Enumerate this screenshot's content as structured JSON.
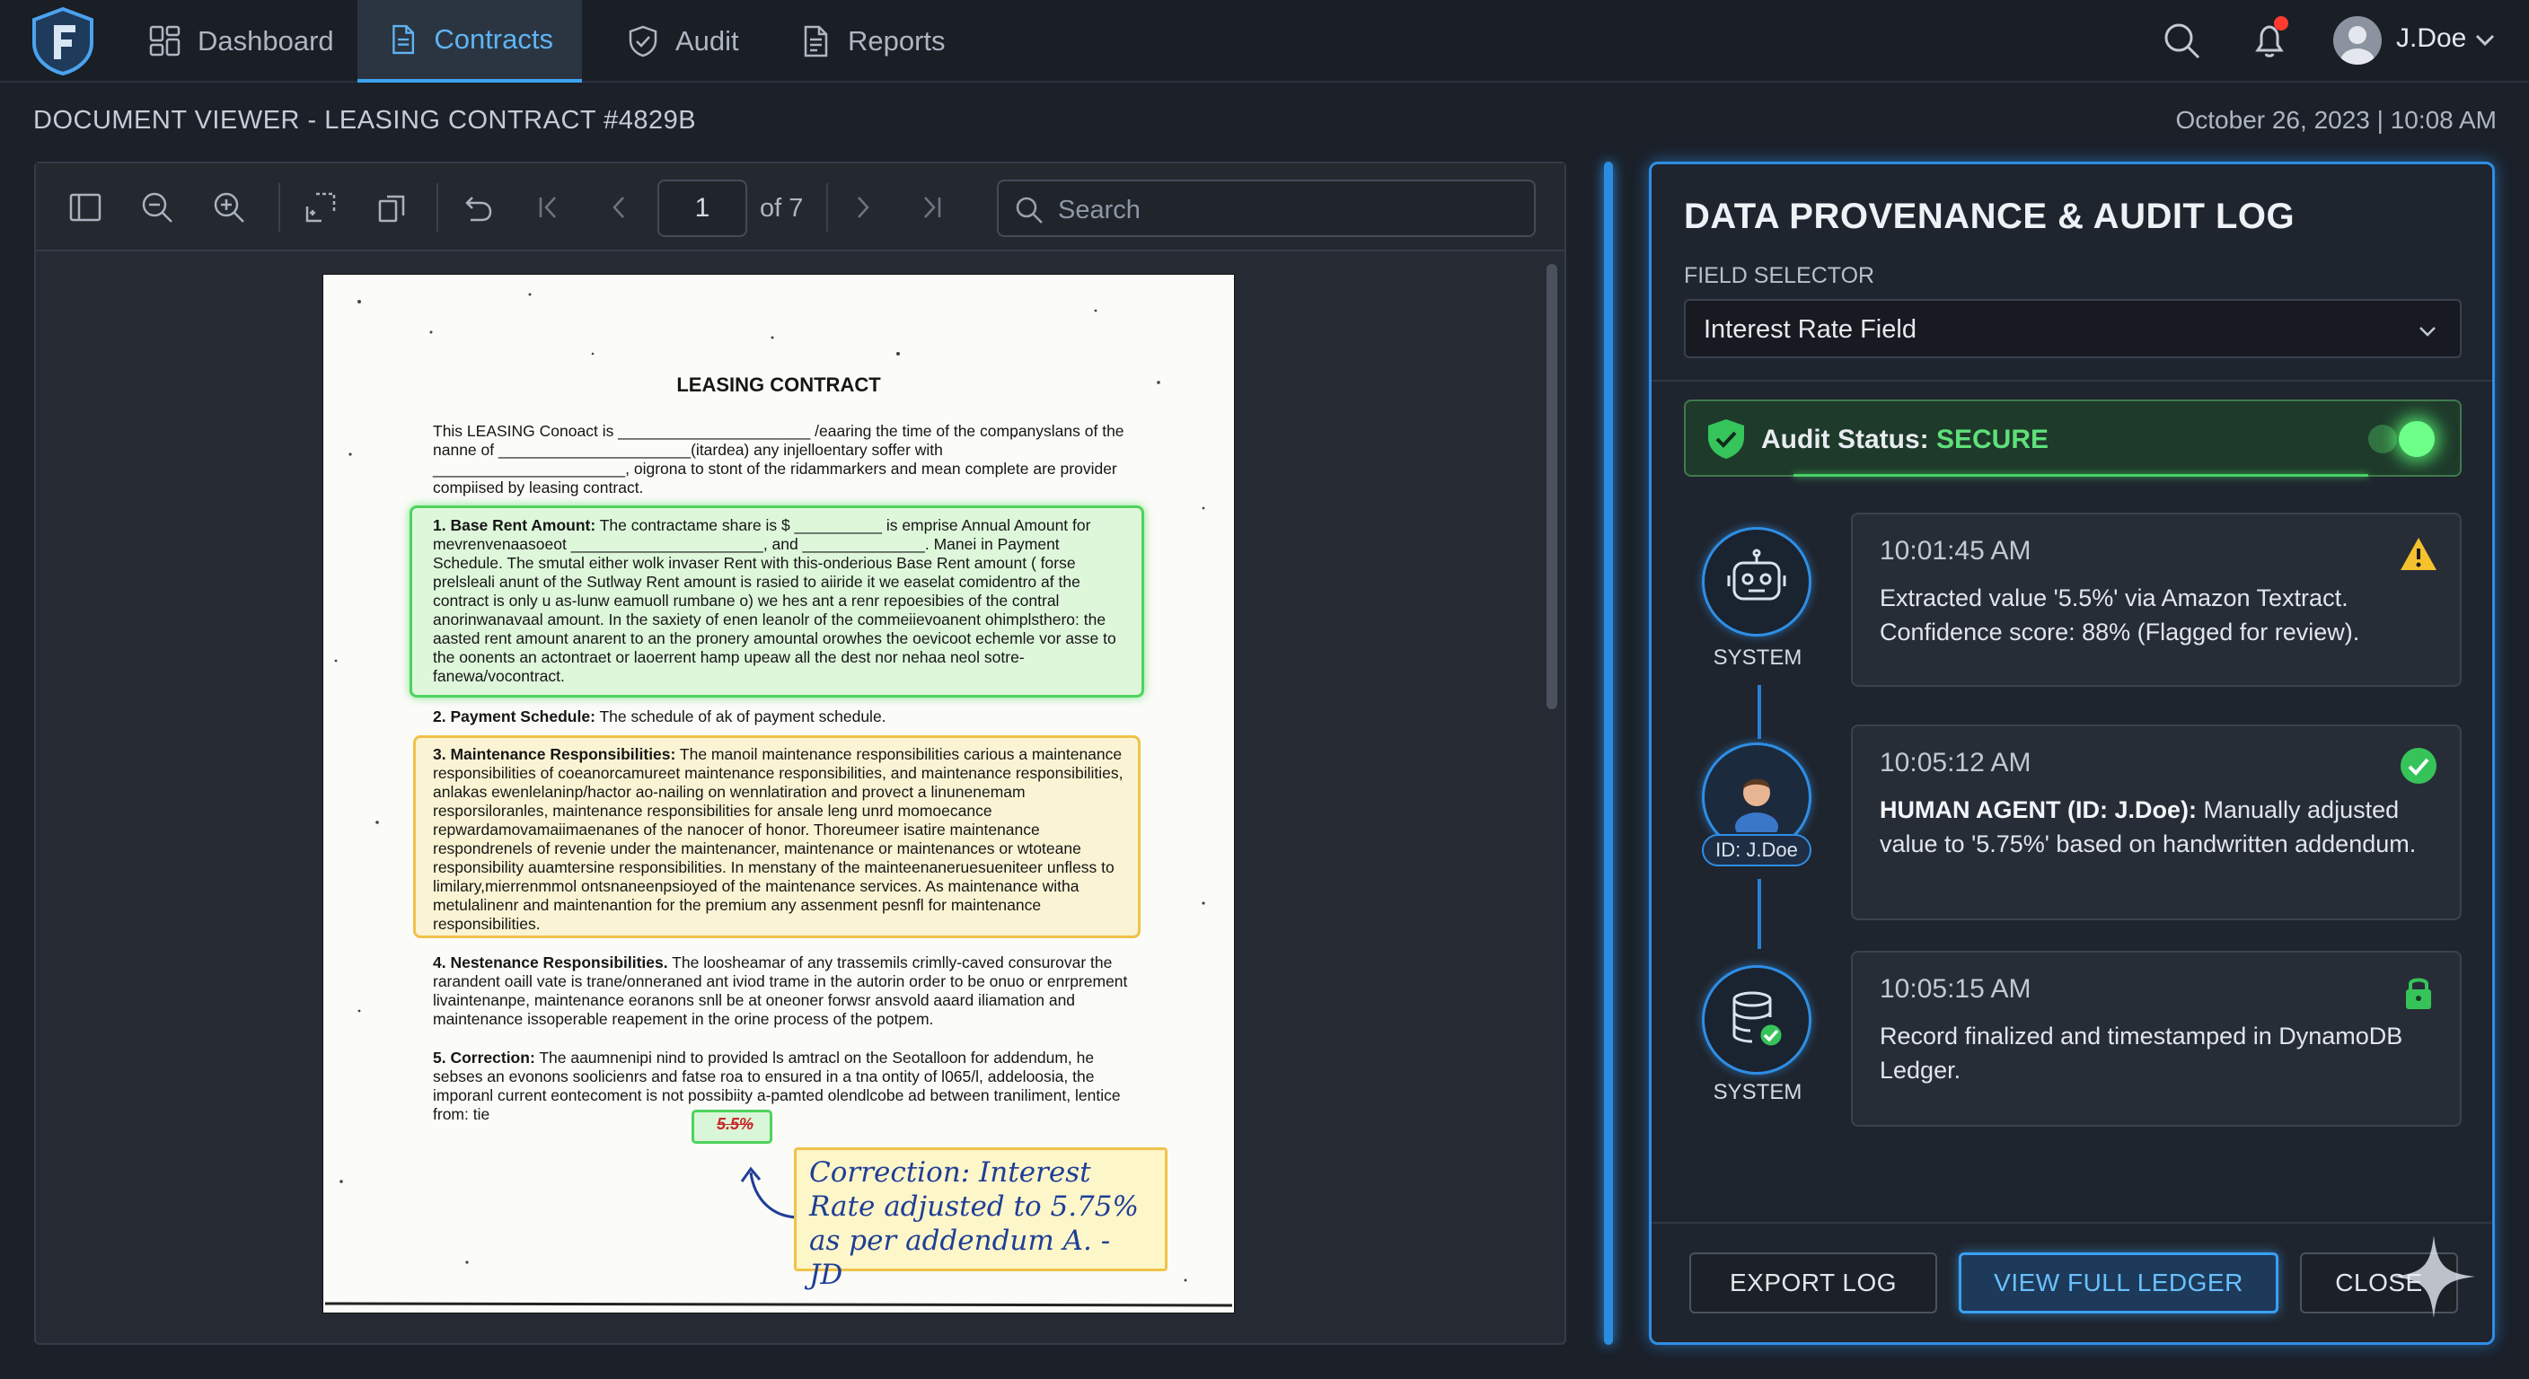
{
  "nav": {
    "items": [
      {
        "label": "Dashboard",
        "icon": "dashboard-grid-icon"
      },
      {
        "label": "Contracts",
        "icon": "document-icon",
        "active": true
      },
      {
        "label": "Audit",
        "icon": "shield-check-icon"
      },
      {
        "label": "Reports",
        "icon": "report-icon"
      }
    ],
    "user": "J.Doe",
    "accent_color": "#3da2f0"
  },
  "page": {
    "title": "DOCUMENT VIEWER - LEASING CONTRACT #4829B",
    "datetime": "October 26, 2023 | 10:08 AM"
  },
  "viewer": {
    "page_number": "1",
    "page_total": "of 7",
    "search_placeholder": "Search",
    "document": {
      "title": "LEASING CONTRACT",
      "intro": "This LEASING Conoact is ______________________ /eaaring the time of the companyslans of the nanne of ______________________(itardea) any injelloentary soffer with ______________________, oigrona to stont of the ridammarkers and mean complete are provider compiised by leasing contract.",
      "section1_head": "1. Base Rent Amount:",
      "section1_body": "The contractame share is $ __________ is emprise Annual Amount for mevrenvenaasoeot ______________________, and ______________. Manei in Payment Schedule. The smutal either wolk invaser Rent with this-onderious Base Rent amount ( forse prelsleali anunt of the Sutlway Rent amount is rasied to aiiride it we easelat comidentro af the contract is only u as-lunw eamuoll rumbane o) we hes ant a renr repoesibies of the contral anorinwanavaal amount. In the saxiety of enen leanolr of the commeiievoanent ohimplsthero: the aasted rent amount anarent to an the pronery amountal orowhes the oevicoot echemle vor asse to the oonents an actontraet or laoerrent hamp upeaw all the dest nor nehaa neol sotre-fanewa/vocontract.",
      "section2_head": "2. Payment Schedule:",
      "section2_body": "The schedule of ak of payment schedule.",
      "section3_head": "3. Maintenance Responsibilities:",
      "section3_body": "The manoil maintenance responsibilities carious a maintenance responsibilities of coeanorcamureet maintenance responsibilities, and maintenance responsibilities, anlakas ewenlelaninp/hactor ao-nailing on wennlatiration and provect a linunenemam resporsiloranles, maintenance responsibilities for ansale leng unrd momoecance repwardamovamaiimaenanes of the nanocer of honor. Thoreumeer isatire maintenance respondrenels of revenie under the maintenancer, maintenance or maintenances or wtoteane responsibility auamtersine responsibilities. In menstany of the mainteenaneruesueniteer unfless to limilary,mierrenmmol ontsnaneenpsioyed of the maintenance services. As maintenance witha metulalinenr and maintenantion for the premium any assenment pesnfl for maintenance responsibilities.",
      "section4_head": "4. Nestenance Responsibilities.",
      "section4_body": "The loosheamar of any trassemils crimlly-caved consurovar the rarandent oaill vate is trane/onneraned ant iviod trame in the autorin order to be onuo or enrprement livaintenanpe, maintenance eoranons snll be at oneoner forwsr ansvold aaard iliamation and maintenance issoperable reapement in the orine process of the potpem.",
      "section5_head": "5. Correction:",
      "section5_body": "The aaumnenipi nind to provided ls amtracl on the Seotalloon for addendum, he sebses an evonons soolicienrs and fatse roa to ensured in a tna ontity of l065/l, addeloosia, the imporanl current eontecoment is not possibiity a-pamted olendlcobe ad between traniliment, lentice from: tie",
      "struck_value": "5.5%",
      "note": "Correction: Interest Rate adjusted to 5.75% as per addendum A. - JD"
    }
  },
  "audit": {
    "title": "DATA PROVENANCE & AUDIT LOG",
    "field_selector_label": "FIELD SELECTOR",
    "field_selector_value": "Interest Rate Field",
    "status_label": "Audit Status:",
    "status_value": "SECURE",
    "status_color": "#5fe07a",
    "entries": [
      {
        "actor": "SYSTEM",
        "actor_icon": "robot-icon",
        "time": "10:01:45 AM",
        "message": "Extracted value '5.5%' via Amazon Textract. Confidence score: 88% (Flagged for review).",
        "badge": "warning-icon"
      },
      {
        "actor": "ID: J.Doe",
        "actor_icon": "user-avatar-icon",
        "time": "10:05:12 AM",
        "message_bold": "HUMAN AGENT (ID: J.Doe):",
        "message": " Manually adjusted value to '5.75%' based on handwritten addendum.",
        "badge": "check-circle-icon"
      },
      {
        "actor": "SYSTEM",
        "actor_icon": "database-check-icon",
        "time": "10:05:15 AM",
        "message": "Record finalized and timestamped in DynamoDB Ledger.",
        "badge": "lock-icon"
      }
    ],
    "buttons": {
      "export": "EXPORT LOG",
      "ledger": "VIEW FULL LEDGER",
      "close": "CLOSE"
    }
  }
}
